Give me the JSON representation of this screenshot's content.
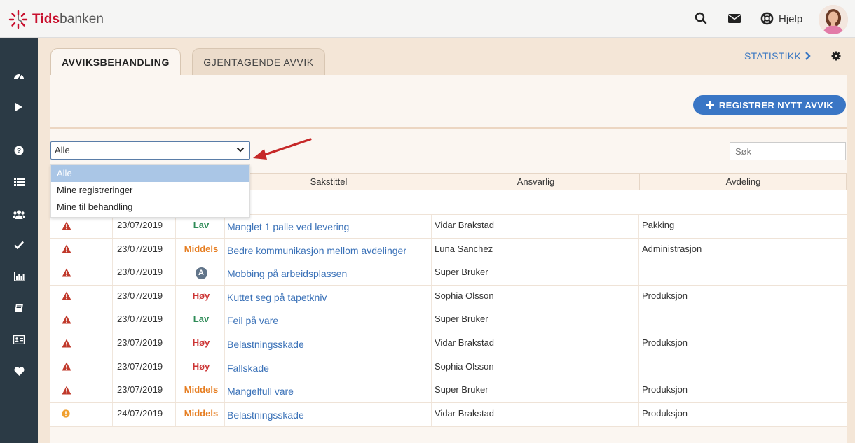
{
  "app": {
    "logo_part1": "Tids",
    "logo_part2": "banken",
    "help_label": "Hjelp"
  },
  "tabs": [
    {
      "label": "AVVIKSBEHANDLING",
      "active": true
    },
    {
      "label": "GJENTAGENDE AVVIK",
      "active": false
    }
  ],
  "statistics_link": "STATISTIKK",
  "register_button": "REGISTRER NYTT AVVIK",
  "filter": {
    "selected": "Alle",
    "options": [
      "Alle",
      "Mine registreringer",
      "Mine til behandling"
    ]
  },
  "search": {
    "placeholder": "Søk"
  },
  "table": {
    "headers": [
      "",
      "",
      "",
      "Sakstittel",
      "Ansvarlig",
      "Avdeling"
    ],
    "rows": [
      {
        "icon": "warning",
        "date": "23/07/2019",
        "priority": "Lav",
        "title": "Manglet 1 palle ved levering",
        "responsible": "Vidar Brakstad",
        "department": "Pakking"
      },
      {
        "icon": "warning",
        "date": "23/07/2019",
        "priority": "Middels",
        "title": "Bedre kommunikasjon mellom avdelinger",
        "responsible": "Luna Sanchez",
        "department": "Administrasjon"
      },
      {
        "icon": "warning",
        "date": "23/07/2019",
        "priority": "A",
        "title": "Mobbing på arbeidsplassen",
        "responsible": "Super Bruker",
        "department": ""
      },
      {
        "icon": "warning",
        "date": "23/07/2019",
        "priority": "Høy",
        "title": "Kuttet seg på tapetkniv",
        "responsible": "Sophia Olsson",
        "department": "Produksjon"
      },
      {
        "icon": "warning",
        "date": "23/07/2019",
        "priority": "Lav",
        "title": "Feil på vare",
        "responsible": "Super Bruker",
        "department": ""
      },
      {
        "icon": "warning",
        "date": "23/07/2019",
        "priority": "Høy",
        "title": "Belastningsskade",
        "responsible": "Vidar Brakstad",
        "department": "Produksjon"
      },
      {
        "icon": "warning",
        "date": "23/07/2019",
        "priority": "Høy",
        "title": "Fallskade",
        "responsible": "Sophia Olsson",
        "department": ""
      },
      {
        "icon": "warning",
        "date": "23/07/2019",
        "priority": "Middels",
        "title": "Mangelfull vare",
        "responsible": "Super Bruker",
        "department": "Produksjon"
      },
      {
        "icon": "info-orange",
        "date": "24/07/2019",
        "priority": "Middels",
        "title": "Belastningsskade",
        "responsible": "Vidar Brakstad",
        "department": "Produksjon"
      }
    ]
  },
  "colors": {
    "priority_low": "#2e8b57",
    "priority_medium": "#e67e22",
    "priority_high": "#cc3333",
    "warning_icon": "#c0392b",
    "link": "#3b72b8",
    "accent": "#3a76c5",
    "sidebar": "#2b3a45"
  },
  "icons": {
    "topbar": [
      "search-icon",
      "mail-icon",
      "lifebuoy-icon"
    ],
    "sidebar": [
      "dashboard-icon",
      "play-icon",
      "question-icon",
      "list-icon",
      "users-icon",
      "check-icon",
      "bar-chart-icon",
      "book-icon",
      "id-card-icon",
      "heart-icon"
    ]
  }
}
